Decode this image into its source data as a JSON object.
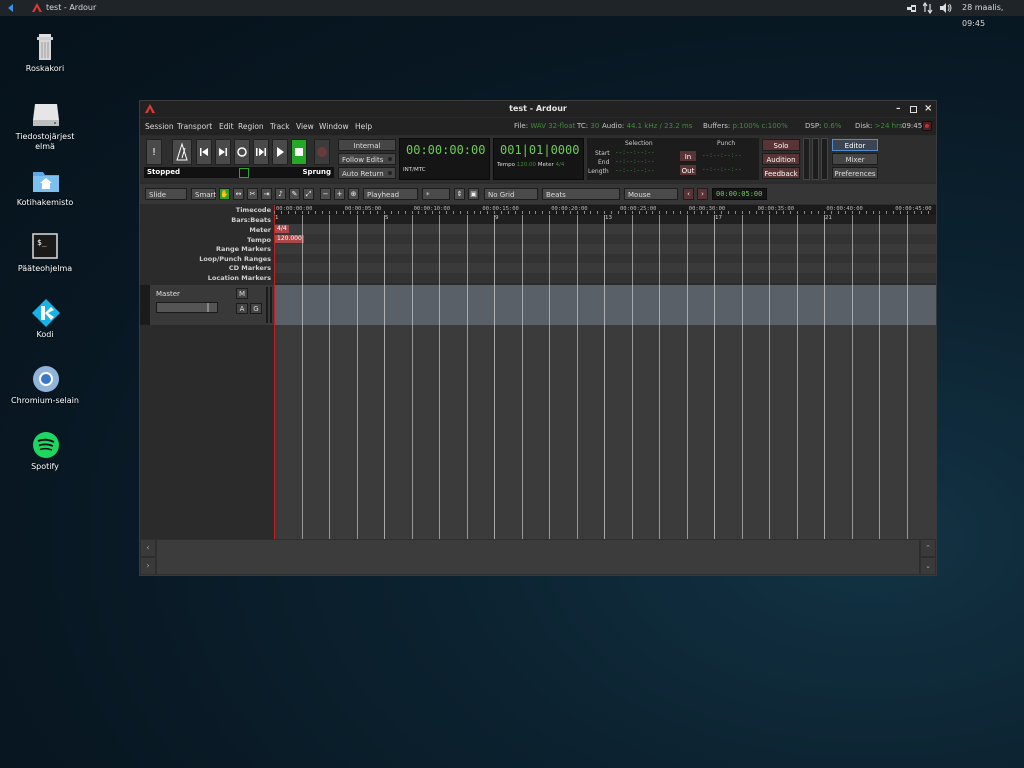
{
  "panel": {
    "window_title": "test - Ardour",
    "datetime": "28 maalis, 09:45"
  },
  "desktop": {
    "icons": [
      {
        "name": "trash",
        "label": "Roskakori"
      },
      {
        "name": "filesystem",
        "label": "Tiedostojärjest elmä"
      },
      {
        "name": "home",
        "label": "Kotihakemisto"
      },
      {
        "name": "terminal",
        "label": "Pääteohjelma"
      },
      {
        "name": "kodi",
        "label": "Kodi"
      },
      {
        "name": "chromium",
        "label": "Chromium-selain"
      },
      {
        "name": "spotify",
        "label": "Spotify"
      }
    ]
  },
  "window": {
    "title": "test - Ardour",
    "menu": [
      "Session",
      "Transport",
      "Edit",
      "Region",
      "Track",
      "View",
      "Window",
      "Help"
    ],
    "status": {
      "file_label": "File:",
      "file_value": "WAV 32-float",
      "tc_label": "TC:",
      "tc_value": "30",
      "audio_label": "Audio:",
      "audio_value": "44.1 kHz / 23.2 ms",
      "buffers_label": "Buffers:",
      "buffers_value": "p:100% c:100%",
      "dsp_label": "DSP:",
      "dsp_value": "0.6%",
      "disk_label": "Disk:",
      "disk_value": ">24 hrs",
      "clock": "09:45"
    },
    "transport": {
      "state": "Stopped",
      "sprung": "Sprung",
      "internal": "Internal",
      "follow_edits": "Follow Edits",
      "auto_return": "Auto Return",
      "primary_clock": "00:00:00:00",
      "primary_sub": "INT/MTC",
      "secondary_clock": "001|01|0000",
      "tempo_label": "Tempo",
      "tempo_value": "120.00",
      "meter_label": "Meter",
      "meter_value": "4/4"
    },
    "selection": {
      "title": "Selection",
      "start": "Start",
      "end": "End",
      "length": "Length",
      "blank": "--:--:--:--",
      "punch_title": "Punch",
      "in": "In",
      "out": "Out"
    },
    "monitor": {
      "solo": "Solo",
      "audition": "Audition",
      "feedback": "Feedback"
    },
    "views": {
      "editor": "Editor",
      "mixer": "Mixer",
      "preferences": "Preferences"
    },
    "edit_toolbar": {
      "edit_mode": "Slide",
      "tool_mode": "Smart",
      "edit_point": "Playhead",
      "nudge": "*",
      "grid": "No Grid",
      "grid_type": "Beats",
      "mouse": "Mouse",
      "nudge_clock": "00:00:05:00"
    },
    "rulers": {
      "labels": [
        "Timecode",
        "Bars:Beats",
        "Meter",
        "Tempo",
        "Range Markers",
        "Loop/Punch Ranges",
        "CD Markers",
        "Location Markers"
      ],
      "timecode": [
        "00:00:00:00",
        "00:00:05:00",
        "00:00:10:00",
        "00:00:15:00",
        "00:00:20:00",
        "00:00:25:00",
        "00:00:30:00",
        "00:00:35:00",
        "00:00:40:00",
        "00:00:45:00"
      ],
      "bars": [
        "1",
        "5",
        "9",
        "13",
        "17",
        "21"
      ],
      "meter_marker": "4/4",
      "tempo_marker": "120.000"
    },
    "track": {
      "name": "Master",
      "mute": "M",
      "automation": "A",
      "group": "G"
    }
  },
  "colors": {
    "accent_green": "#6dcc57",
    "playhead": "#c02020",
    "ardour_red": "#e03838"
  }
}
